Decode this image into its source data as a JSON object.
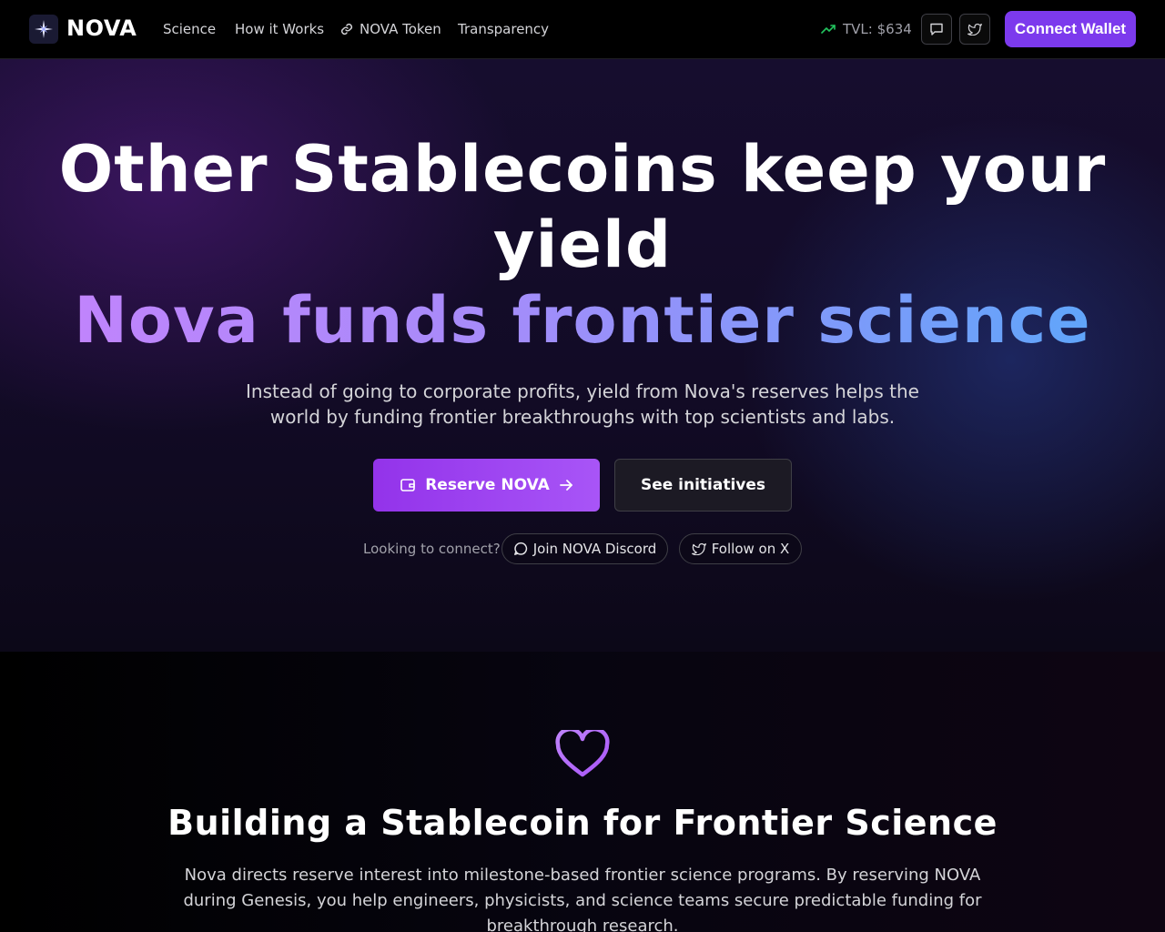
{
  "nav": {
    "brand": "NOVA",
    "links": [
      "Science",
      "How it Works",
      "NOVA Token",
      "Transparency"
    ],
    "tvl": "TVL: $634",
    "connect_label": "Connect Wallet"
  },
  "hero": {
    "title_line1": "Other Stablecoins keep your",
    "title_line2": "yield",
    "title_highlight": "Nova funds frontier science",
    "subtitle": "Instead of going to corporate profits, yield from Nova's reserves helps the world by funding frontier breakthroughs with top scientists and labs.",
    "primary_button": "Reserve NOVA",
    "secondary_button": "See initiatives",
    "connect_prompt": "Looking to connect?",
    "discord_label": "Join NOVA Discord",
    "x_label": "Follow on X"
  },
  "mission": {
    "title": "Building a Stablecoin for Frontier Science",
    "body": "Nova directs reserve interest into milestone-based frontier science programs. By reserving NOVA during Genesis, you help engineers, physicists, and science teams secure predictable funding for breakthrough research."
  },
  "colors": {
    "accent": "#7c3aed",
    "gradient_start": "#c084fc",
    "gradient_end": "#60a5fa",
    "trend_green": "#22c55e"
  },
  "icons": [
    "star-logo-icon",
    "link-icon",
    "trending-up-icon",
    "message-icon",
    "twitter-icon",
    "wallet-icon",
    "arrow-right-icon",
    "heart-icon"
  ]
}
